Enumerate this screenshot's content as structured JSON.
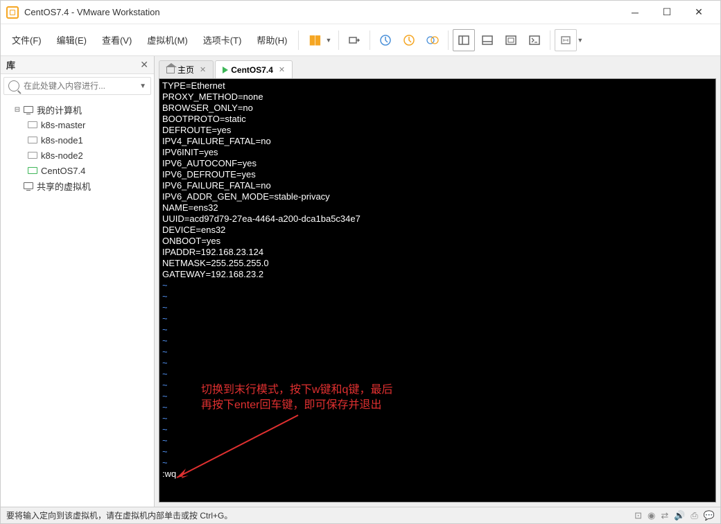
{
  "window": {
    "title": "CentOS7.4 - VMware Workstation"
  },
  "menu": {
    "file": "文件(F)",
    "edit": "编辑(E)",
    "view": "查看(V)",
    "vm": "虚拟机(M)",
    "tabs": "选项卡(T)",
    "help": "帮助(H)"
  },
  "sidebar": {
    "title": "库",
    "search_placeholder": "在此处键入内容进行...",
    "root": "我的计算机",
    "items": [
      {
        "label": "k8s-master",
        "active": false
      },
      {
        "label": "k8s-node1",
        "active": false
      },
      {
        "label": "k8s-node2",
        "active": false
      },
      {
        "label": "CentOS7.4",
        "active": true
      }
    ],
    "shared": "共享的虚拟机"
  },
  "tabs": [
    {
      "label": "主页",
      "type": "home"
    },
    {
      "label": "CentOS7.4",
      "type": "vm"
    }
  ],
  "terminal": {
    "lines": [
      "TYPE=Ethernet",
      "PROXY_METHOD=none",
      "BROWSER_ONLY=no",
      "BOOTPROTO=static",
      "DEFROUTE=yes",
      "IPV4_FAILURE_FATAL=no",
      "IPV6INIT=yes",
      "IPV6_AUTOCONF=yes",
      "IPV6_DEFROUTE=yes",
      "IPV6_FAILURE_FATAL=no",
      "IPV6_ADDR_GEN_MODE=stable-privacy",
      "NAME=ens32",
      "UUID=acd97d79-27ea-4464-a200-dca1ba5c34e7",
      "DEVICE=ens32",
      "ONBOOT=yes",
      "",
      "IPADDR=192.168.23.124",
      "NETMASK=255.255.255.0",
      "GATEWAY=192.168.23.2"
    ],
    "command": ":wq"
  },
  "annotation": {
    "line1": "切换到末行模式，按下w键和q键，最后",
    "line2": "再按下enter回车键，即可保存并退出"
  },
  "statusbar": {
    "text": "要将输入定向到该虚拟机，请在虚拟机内部单击或按 Ctrl+G。"
  }
}
